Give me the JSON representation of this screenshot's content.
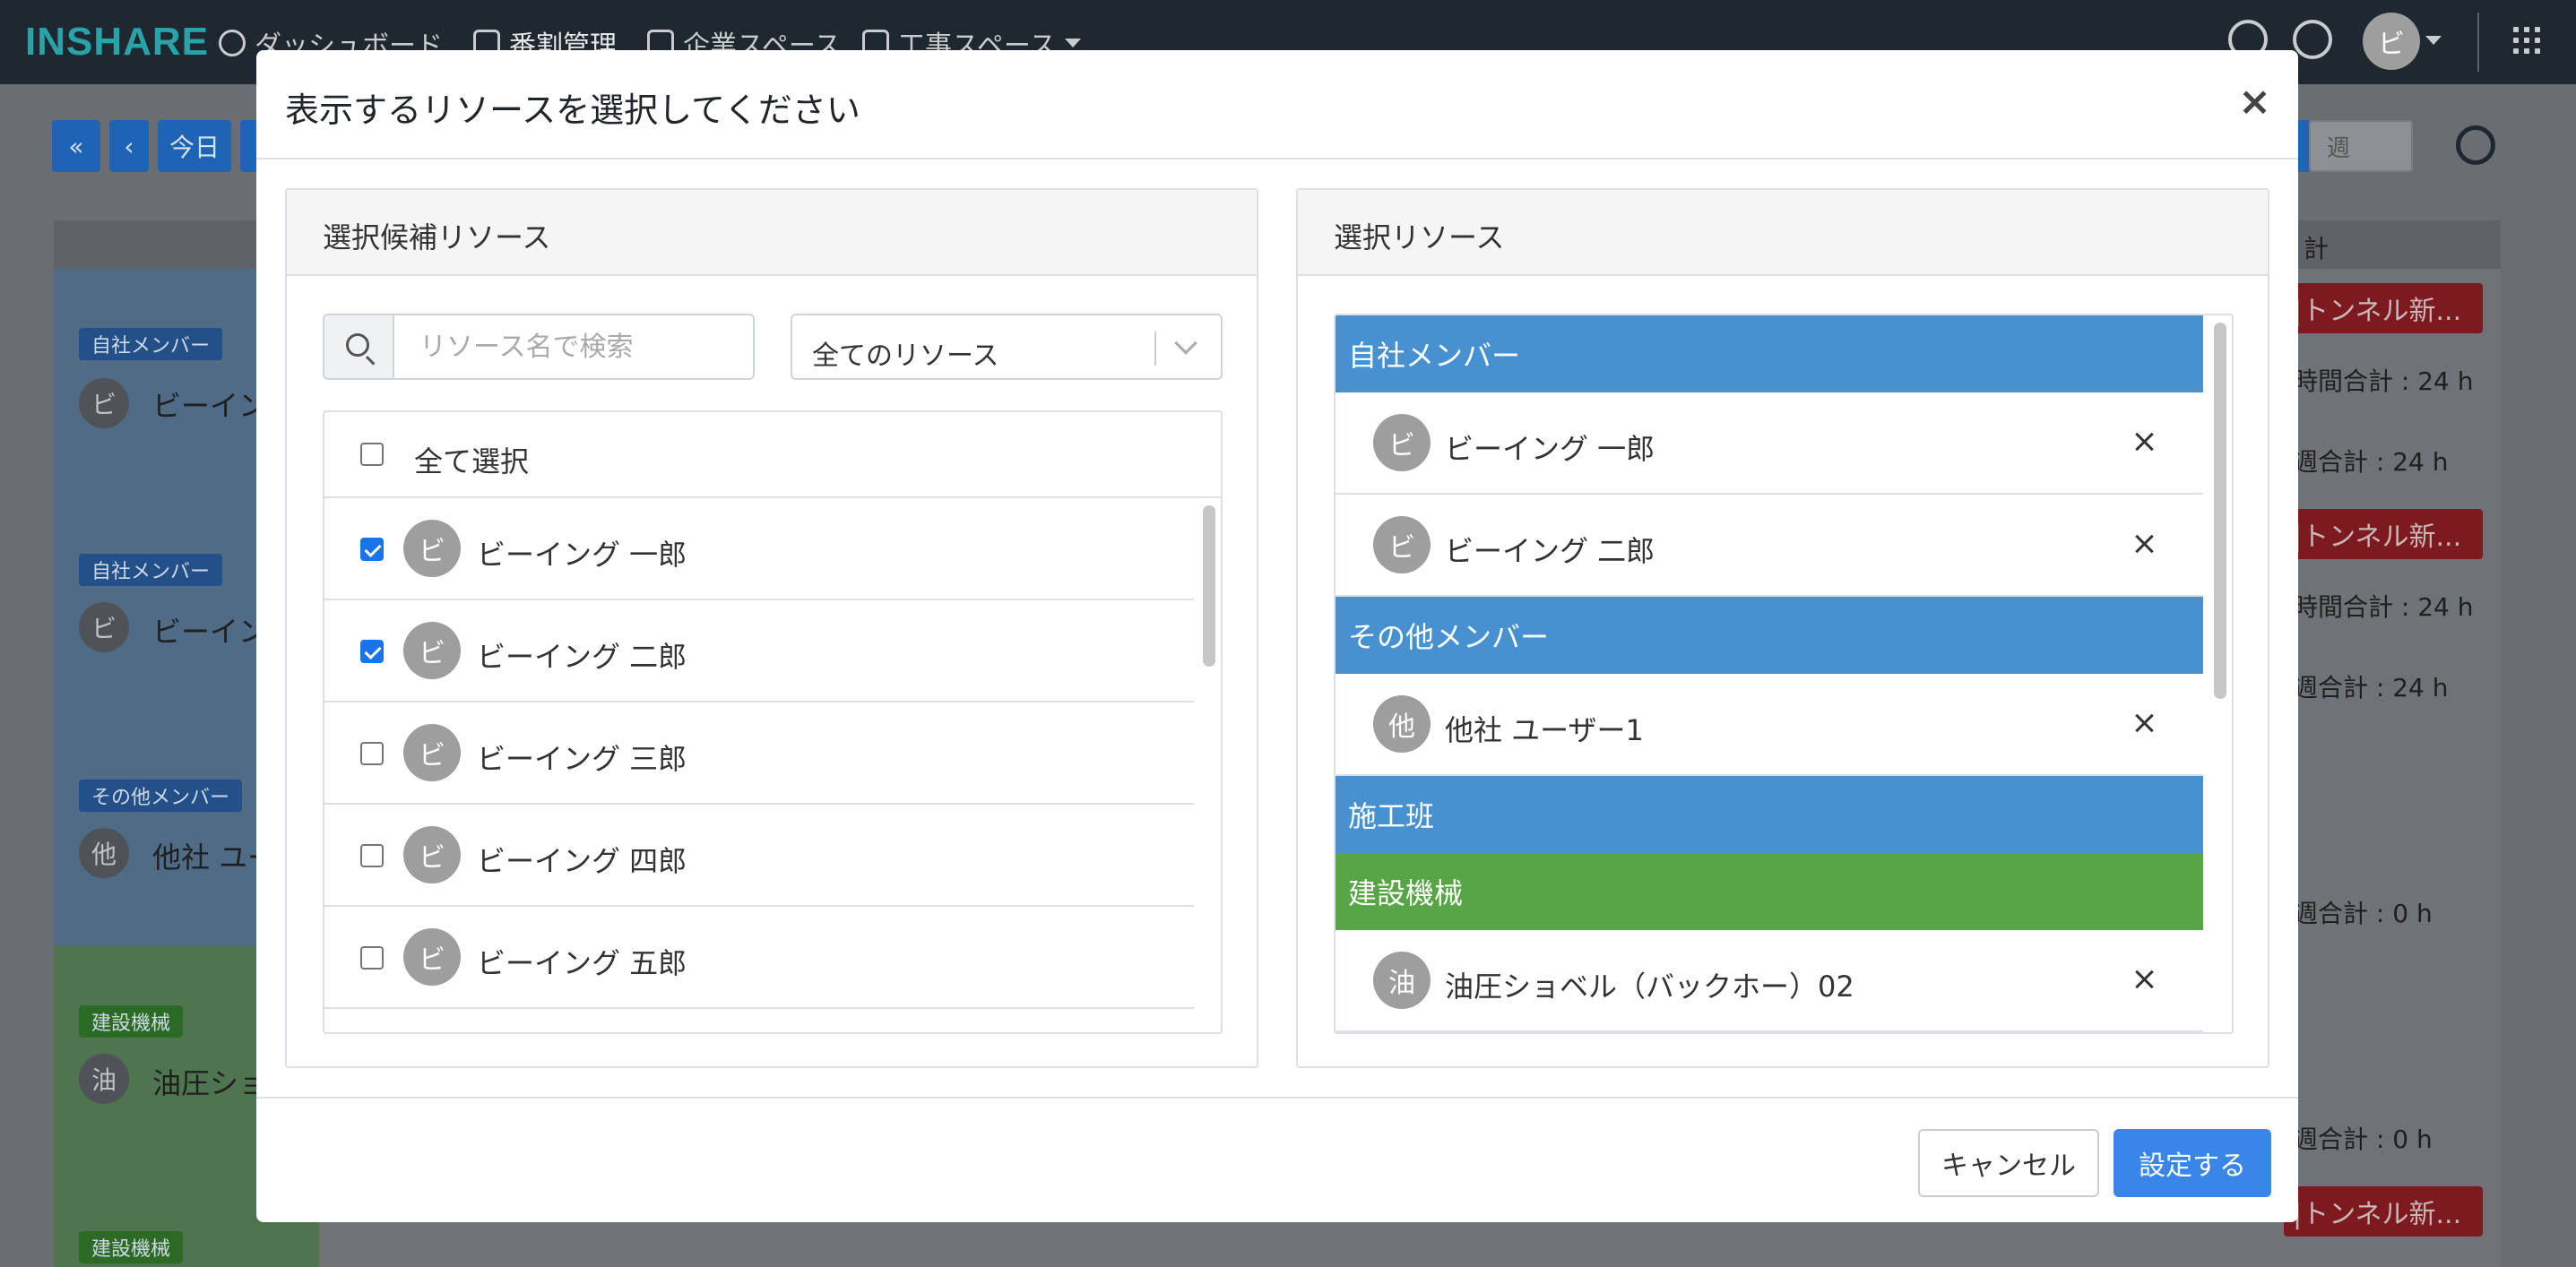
{
  "app": {
    "logo": "INSHARE",
    "nav": [
      {
        "label": "ダッシュボード"
      },
      {
        "label": "番割管理"
      },
      {
        "label": "企業スペース"
      },
      {
        "label": "工事スペース"
      }
    ],
    "user_initial": "ビ"
  },
  "toolbar": {
    "first_label": "«",
    "prev_label": "‹",
    "today_label": "今日",
    "view_select": "週"
  },
  "schedule": {
    "total_header": "計",
    "rows": [
      {
        "tag": "自社メンバー",
        "initial": "ビ",
        "name": "ビーイン",
        "badge": "|トンネル新...",
        "line1": "時間合計 : 24 h",
        "line2": "週合計 : 24 h"
      },
      {
        "tag": "自社メンバー",
        "initial": "ビ",
        "name": "ビーイン",
        "badge": "|トンネル新...",
        "line1": "時間合計 : 24 h",
        "line2": "週合計 : 24 h"
      },
      {
        "tag": "その他メンバー",
        "initial": "他",
        "name": "他社 ユー",
        "line2": "週合計 : 0 h"
      },
      {
        "tag": "建設機械",
        "initial": "油",
        "name": "油圧ショ",
        "line2": "週合計 : 0 h"
      },
      {
        "tag": "建設機械",
        "badge": "|トンネル新..."
      }
    ]
  },
  "modal": {
    "title": "表示するリソースを選択してください",
    "close_label": "×",
    "left_panel": {
      "title": "選択候補リソース",
      "search_placeholder": "リソース名で検索",
      "filter_value": "全てのリソース",
      "select_all_label": "全て選択",
      "items": [
        {
          "initial": "ビ",
          "name": "ビーイング 一郎",
          "checked": true
        },
        {
          "initial": "ビ",
          "name": "ビーイング 二郎",
          "checked": true
        },
        {
          "initial": "ビ",
          "name": "ビーイング 三郎",
          "checked": false
        },
        {
          "initial": "ビ",
          "name": "ビーイング 四郎",
          "checked": false
        },
        {
          "initial": "ビ",
          "name": "ビーイング 五郎",
          "checked": false
        }
      ]
    },
    "right_panel": {
      "title": "選択リソース",
      "groups": [
        {
          "label": "自社メンバー",
          "color": "#4891d0",
          "items": [
            {
              "initial": "ビ",
              "name": "ビーイング 一郎"
            },
            {
              "initial": "ビ",
              "name": "ビーイング 二郎"
            }
          ]
        },
        {
          "label": "その他メンバー",
          "color": "#4891d0",
          "items": [
            {
              "initial": "他",
              "name": "他社 ユーザー1"
            }
          ]
        },
        {
          "label": "施工班",
          "color": "#4891d0",
          "items": []
        },
        {
          "label": "建設機械",
          "color": "#58a548",
          "items": [
            {
              "initial": "油",
              "name": "油圧ショベル（バックホー）02"
            }
          ]
        }
      ]
    },
    "footer": {
      "cancel_label": "キャンセル",
      "submit_label": "設定する"
    }
  }
}
